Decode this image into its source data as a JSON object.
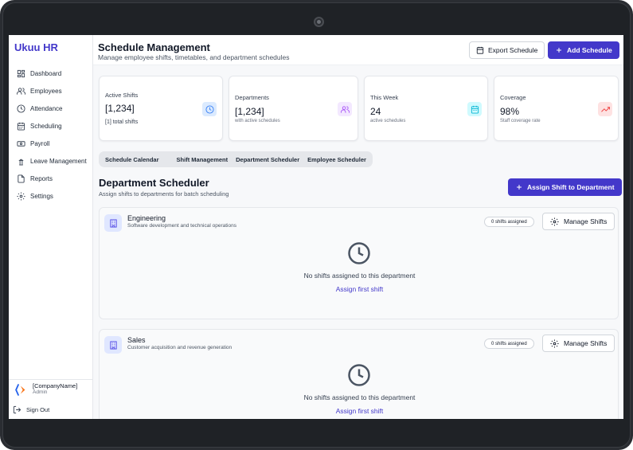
{
  "app": {
    "brand": "Ukuu HR"
  },
  "sidebar": {
    "items": [
      {
        "label": "Dashboard",
        "icon": "dashboard-icon"
      },
      {
        "label": "Employees",
        "icon": "users-icon"
      },
      {
        "label": "Attendance",
        "icon": "clock-icon"
      },
      {
        "label": "Scheduling",
        "icon": "calendar-icon"
      },
      {
        "label": "Payroll",
        "icon": "banknote-icon"
      },
      {
        "label": "Leave Management",
        "icon": "leave-icon"
      },
      {
        "label": "Reports",
        "icon": "file-icon"
      },
      {
        "label": "Settings",
        "icon": "gear-icon"
      }
    ],
    "company": {
      "name": "[CompanyName]",
      "role": "Admin"
    },
    "signout_label": "Sign Out"
  },
  "header": {
    "title": "Schedule Management",
    "subtitle": "Manage employee shifts, timetables, and department schedules",
    "export_label": "Export Schedule",
    "add_label": "Add Schedule"
  },
  "stats": [
    {
      "label": "Active Shifts",
      "value": "[1,234]",
      "note": "[1] total shifts",
      "icon": "clock-icon",
      "color": "#3b82f6"
    },
    {
      "label": "Departments",
      "value": "[1,234]",
      "note": "with active schedules",
      "icon": "users-icon",
      "color": "#a855f7"
    },
    {
      "label": "This Week",
      "value": "24",
      "note": "active schedules",
      "icon": "calendar-icon",
      "color": "#06b6d4"
    },
    {
      "label": "Coverage",
      "value": "98%",
      "note": "Staff coverage rate",
      "icon": "trending-up-icon",
      "color": "#ef4444"
    }
  ],
  "tabs": [
    {
      "label": "Schedule Calendar"
    },
    {
      "label": "Shift Management"
    },
    {
      "label": "Department Scheduler"
    },
    {
      "label": "Employee Scheduler"
    }
  ],
  "section": {
    "title": "Department Scheduler",
    "subtitle": "Assign shifts to departments for batch scheduling",
    "assign_label": "Assign Shift to Department"
  },
  "departments": [
    {
      "name": "Engineering",
      "description": "Software development and technical operations",
      "badge": "0 shifts assigned",
      "manage_label": "Manage Shifts",
      "empty_text": "No shifts assigned to this department",
      "empty_link": "Assign first shift"
    },
    {
      "name": "Sales",
      "description": "Customer acquisition and revenue generation",
      "badge": "0 shifts assigned",
      "manage_label": "Manage Shifts",
      "empty_text": "No shifts assigned to this department",
      "empty_link": "Assign first shift"
    }
  ],
  "colors": {
    "accent": "#4338ca"
  }
}
